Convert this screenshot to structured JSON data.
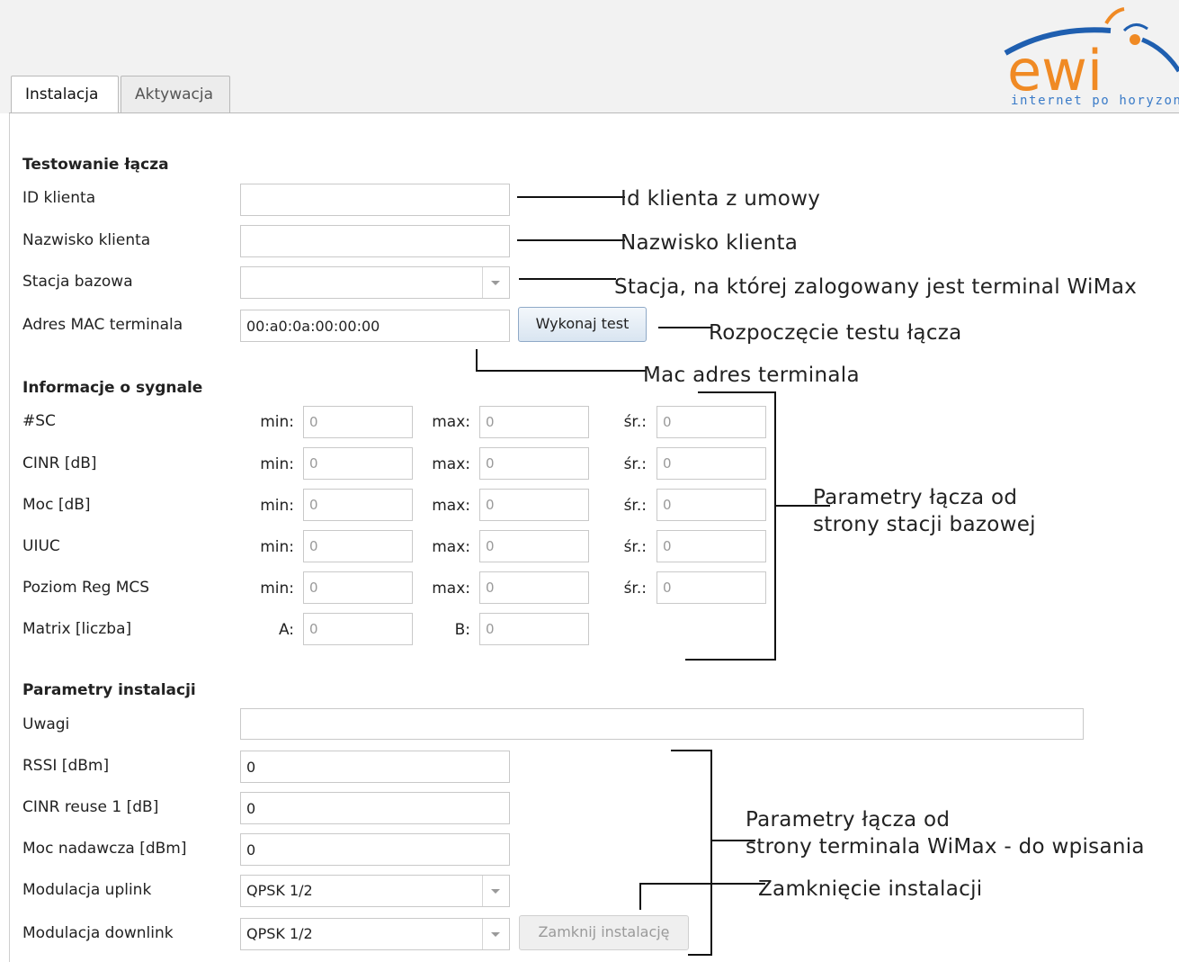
{
  "logo": {
    "wordmark": "ewi",
    "tagline": "internet po horyzon"
  },
  "tabs": [
    {
      "label": "Instalacja",
      "active": true
    },
    {
      "label": "Aktywacja",
      "active": false
    }
  ],
  "link_test": {
    "title": "Testowanie łącza",
    "client_id": {
      "label": "ID klienta",
      "value": ""
    },
    "client_name": {
      "label": "Nazwisko klienta",
      "value": ""
    },
    "base_station": {
      "label": "Stacja bazowa",
      "value": ""
    },
    "mac": {
      "label": "Adres MAC terminala",
      "value": "00:a0:0a:00:00:00"
    },
    "test_button": "Wykonaj test"
  },
  "signal": {
    "title": "Informacje o sygnale",
    "col_min": "min:",
    "col_max": "max:",
    "col_avg": "śr.:",
    "rows": [
      {
        "label": "#SC",
        "min": "0",
        "max": "0",
        "avg": "0"
      },
      {
        "label": "CINR [dB]",
        "min": "0",
        "max": "0",
        "avg": "0"
      },
      {
        "label": "Moc [dB]",
        "min": "0",
        "max": "0",
        "avg": "0"
      },
      {
        "label": "UIUC",
        "min": "0",
        "max": "0",
        "avg": "0"
      },
      {
        "label": "Poziom Reg MCS",
        "min": "0",
        "max": "0",
        "avg": "0"
      }
    ],
    "matrix": {
      "label": "Matrix [liczba]",
      "a_label": "A:",
      "a": "0",
      "b_label": "B:",
      "b": "0"
    }
  },
  "install": {
    "title": "Parametry instalacji",
    "notes": {
      "label": "Uwagi",
      "value": ""
    },
    "rssi": {
      "label": "RSSI [dBm]",
      "value": "0"
    },
    "cinr": {
      "label": "CINR reuse 1 [dB]",
      "value": "0"
    },
    "power": {
      "label": "Moc nadawcza [dBm]",
      "value": "0"
    },
    "uplink": {
      "label": "Modulacja uplink",
      "value": "QPSK 1/2"
    },
    "downlink": {
      "label": "Modulacja downlink",
      "value": "QPSK 1/2"
    },
    "close_button": "Zamknij instalację"
  },
  "annotations": {
    "client_id": "Id klienta z umowy",
    "client_name": "Nazwisko klienta",
    "station": "Stacja, na której zalogowany jest terminal WiMax",
    "test": "Rozpoczęcie testu łącza",
    "mac": "Mac adres terminala",
    "bs_params_1": "Parametry łącza od",
    "bs_params_2": "strony stacji bazowej",
    "term_params_1": "Parametry łącza od",
    "term_params_2": "strony terminala WiMax - do wpisania",
    "close": "Zamknięcie instalacji"
  },
  "colors": {
    "logo_blue": "#1f5fb0",
    "logo_orange": "#f08a24",
    "button_border": "#8fa9c7"
  }
}
